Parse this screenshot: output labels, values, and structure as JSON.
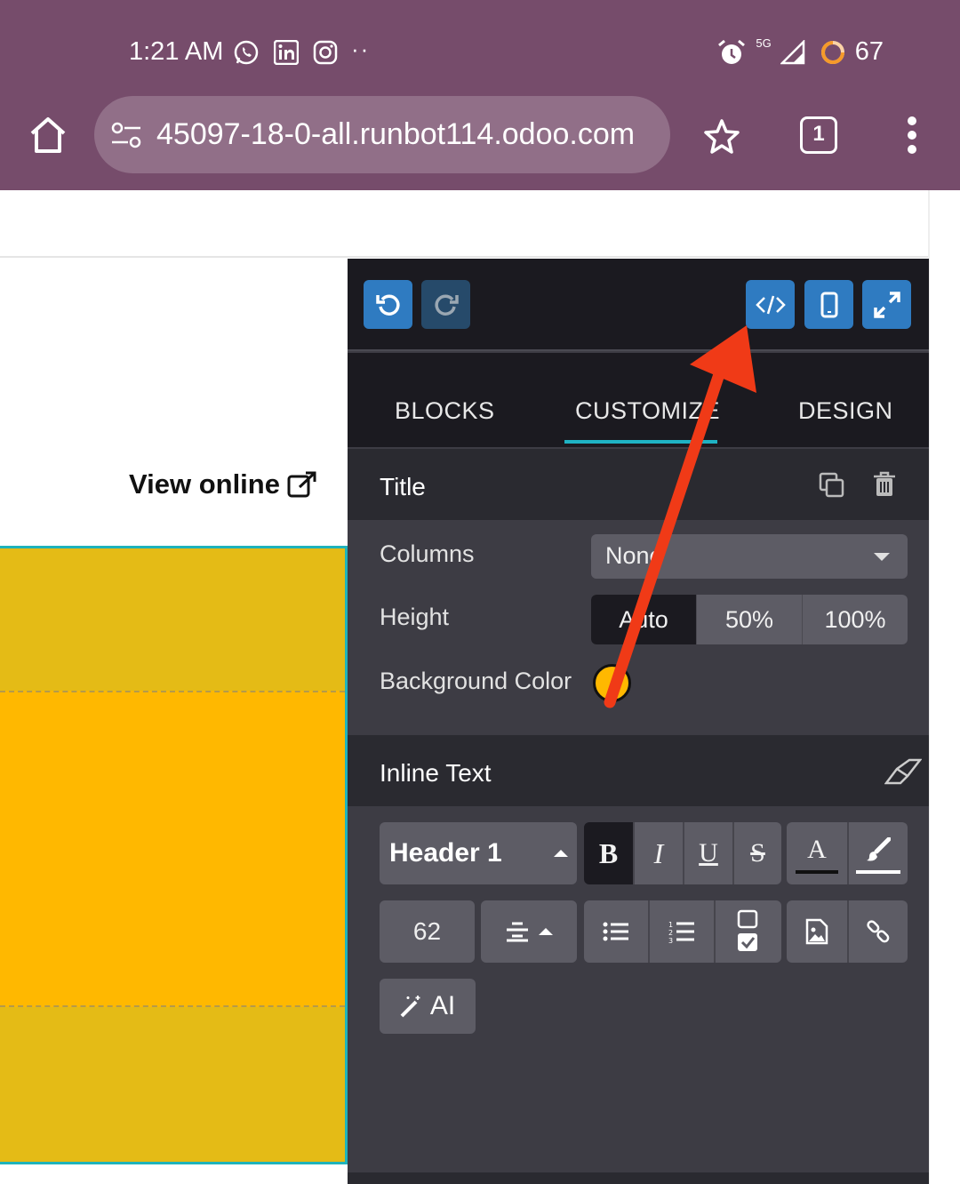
{
  "status_bar": {
    "time": "1:21 AM",
    "network": "5G",
    "battery": "67"
  },
  "browser": {
    "url": "45097-18-0-all.runbot114.odoo.com",
    "tab_count": "1"
  },
  "page": {
    "view_online": "View online",
    "block_colors": {
      "outer": "#e4bb16",
      "inner": "#ffb800",
      "border": "#1fb3bb"
    }
  },
  "editor": {
    "tabs": [
      "BLOCKS",
      "CUSTOMIZE",
      "DESIGN"
    ],
    "active_tab": "CUSTOMIZE",
    "title_section": {
      "title": "Title",
      "columns_label": "Columns",
      "columns_value": "None",
      "height_label": "Height",
      "height_options": [
        "Auto",
        "50%",
        "100%"
      ],
      "height_selected": "Auto",
      "bg_label": "Background Color",
      "bg_color": "#ffb800"
    },
    "inline_text": {
      "title": "Inline Text",
      "style_select": "Header 1",
      "bold": "B",
      "italic": "I",
      "underline": "U",
      "strike": "S",
      "font_color": "A",
      "font_size": "62",
      "ai_label": "AI"
    }
  },
  "annotation": {
    "arrow_color": "#f03a17"
  }
}
